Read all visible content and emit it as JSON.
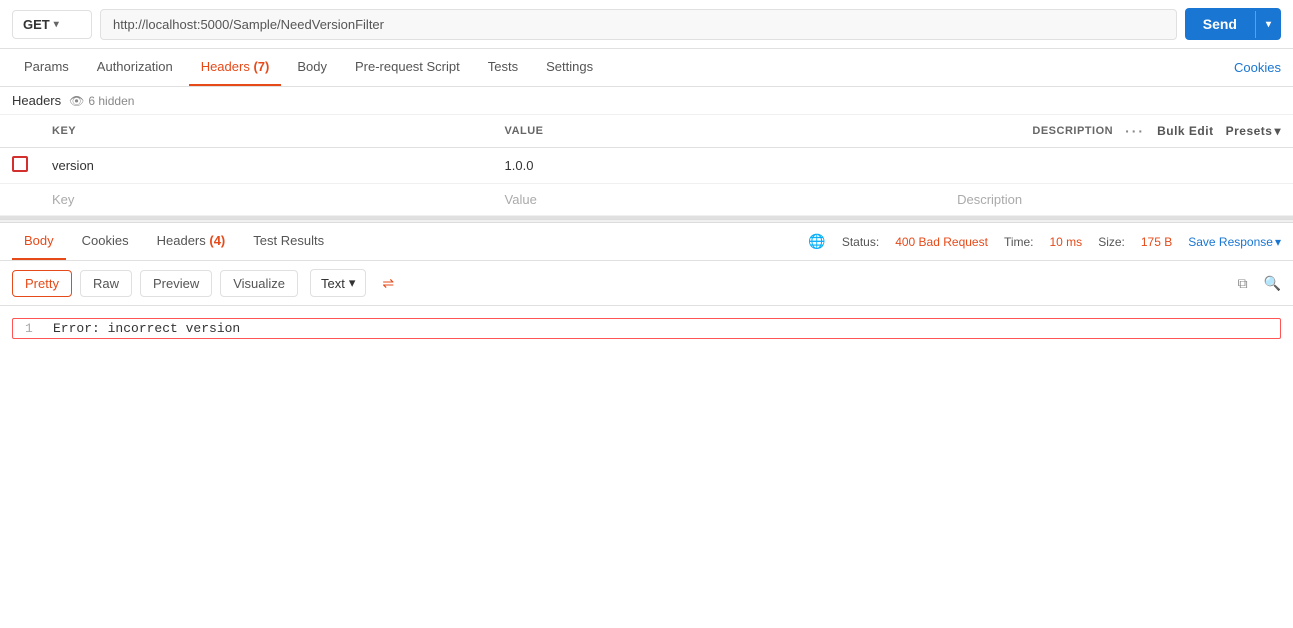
{
  "urlBar": {
    "method": "GET",
    "chevron": "▾",
    "url": "http://localhost:5000/Sample/NeedVersionFilter",
    "sendLabel": "Send",
    "sendArrow": "▾"
  },
  "requestTabs": [
    {
      "id": "params",
      "label": "Params",
      "active": false,
      "badge": null
    },
    {
      "id": "authorization",
      "label": "Authorization",
      "active": false,
      "badge": null
    },
    {
      "id": "headers",
      "label": "Headers",
      "active": true,
      "badge": "(7)"
    },
    {
      "id": "body",
      "label": "Body",
      "active": false,
      "badge": null
    },
    {
      "id": "prerequest",
      "label": "Pre-request Script",
      "active": false,
      "badge": null
    },
    {
      "id": "tests",
      "label": "Tests",
      "active": false,
      "badge": null
    },
    {
      "id": "settings",
      "label": "Settings",
      "active": false,
      "badge": null
    }
  ],
  "cookiesLink": "Cookies",
  "headersSubRow": {
    "label": "Headers",
    "hiddenCount": "6 hidden"
  },
  "headersTable": {
    "columns": {
      "key": "KEY",
      "value": "VALUE",
      "description": "DESCRIPTION",
      "threeDots": "···",
      "bulkEdit": "Bulk Edit",
      "presets": "Presets",
      "presetsChevron": "▾"
    },
    "rows": [
      {
        "checked": false,
        "key": "version",
        "value": "1.0.0",
        "description": ""
      }
    ],
    "placeholder": {
      "key": "Key",
      "value": "Value",
      "description": "Description"
    }
  },
  "responseTabs": [
    {
      "id": "body",
      "label": "Body",
      "active": true,
      "badge": null
    },
    {
      "id": "cookies",
      "label": "Cookies",
      "active": false,
      "badge": null
    },
    {
      "id": "headers",
      "label": "Headers",
      "active": false,
      "badge": "(4)"
    },
    {
      "id": "testresults",
      "label": "Test Results",
      "active": false,
      "badge": null
    }
  ],
  "statusBar": {
    "statusLabel": "Status:",
    "statusValue": "400 Bad Request",
    "timeLabel": "Time:",
    "timeValue": "10 ms",
    "sizeLabel": "Size:",
    "sizeValue": "175 B",
    "saveResponse": "Save Response",
    "saveChevron": "▾"
  },
  "bodySubtabs": [
    {
      "id": "pretty",
      "label": "Pretty",
      "active": true
    },
    {
      "id": "raw",
      "label": "Raw",
      "active": false
    },
    {
      "id": "preview",
      "label": "Preview",
      "active": false
    },
    {
      "id": "visualize",
      "label": "Visualize",
      "active": false
    }
  ],
  "textDropdown": {
    "label": "Text",
    "chevron": "▾"
  },
  "responseContent": {
    "lineNumber": "1",
    "lineText": "Error: incorrect version"
  }
}
